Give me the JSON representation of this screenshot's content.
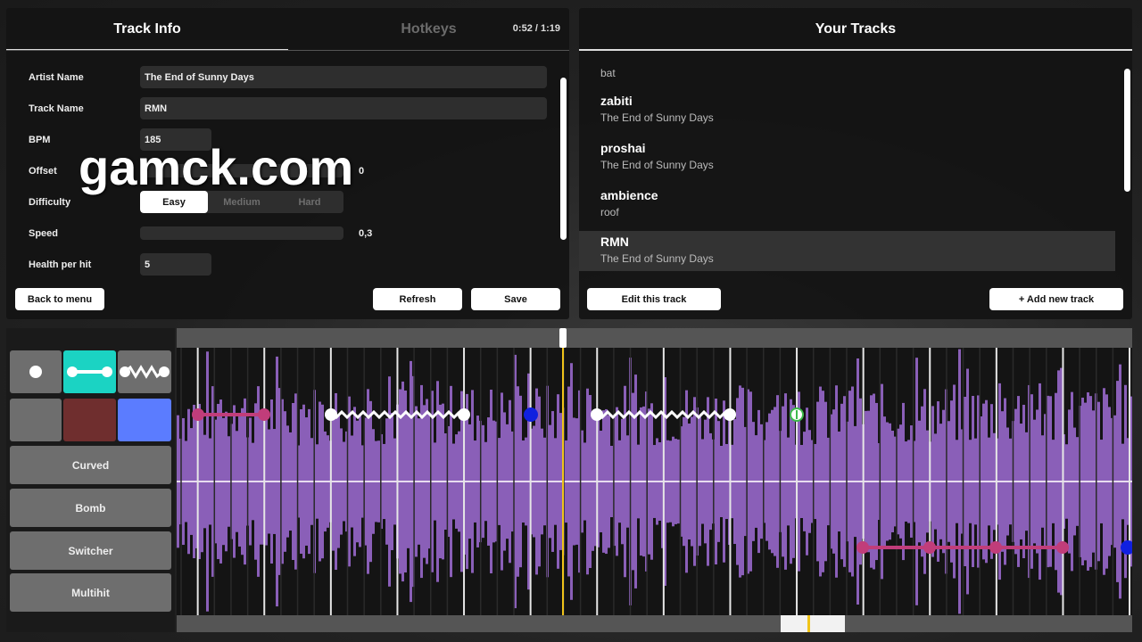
{
  "watermark": "gamck.com",
  "tabs": {
    "track_info": "Track Info",
    "hotkeys": "Hotkeys",
    "time": "0:52 / 1:19"
  },
  "form": {
    "artist_label": "Artist Name",
    "artist_value": "The End of Sunny Days",
    "track_label": "Track Name",
    "track_value": "RMN",
    "bpm_label": "BPM",
    "bpm_value": "185",
    "offset_label": "Offset",
    "offset_value": "0",
    "difficulty_label": "Difficulty",
    "difficulty_options": [
      "Easy",
      "Medium",
      "Hard"
    ],
    "difficulty_selected": "Easy",
    "speed_label": "Speed",
    "speed_value": "0,3",
    "health_label": "Health per hit",
    "health_value": "5"
  },
  "buttons": {
    "back": "Back to menu",
    "refresh": "Refresh",
    "save": "Save",
    "edit": "Edit this track",
    "add": "+ Add new track"
  },
  "your_tracks": {
    "title": "Your Tracks",
    "items": [
      {
        "title": "",
        "artist": "bat"
      },
      {
        "title": "zabiti",
        "artist": "The End of Sunny Days"
      },
      {
        "title": "proshai",
        "artist": "The End of Sunny Days"
      },
      {
        "title": "ambience",
        "artist": "roof"
      },
      {
        "title": "RMN",
        "artist": "The End of Sunny Days"
      }
    ]
  },
  "tools": {
    "curved": "Curved",
    "bomb": "Bomb",
    "switcher": "Switcher",
    "multihit": "Multihit"
  },
  "colors": {
    "accent_teal": "#1bd3c3",
    "tool_red": "#6f2e2e",
    "tool_blue": "#5b7cff",
    "waveform": "#8a5fb8",
    "playhead": "#f0c419",
    "hold_pink": "#c13d7a",
    "blue_note": "#1020e0",
    "switch_green": "#3dbb4d"
  }
}
